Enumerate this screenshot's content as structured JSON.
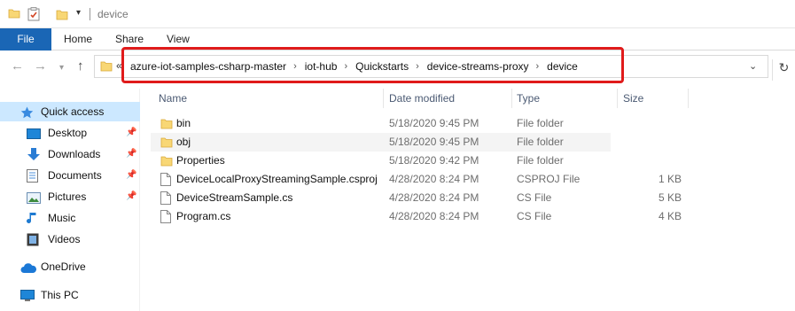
{
  "window": {
    "title": "device"
  },
  "ribbon": {
    "tabs": [
      {
        "label": "File"
      },
      {
        "label": "Home"
      },
      {
        "label": "Share"
      },
      {
        "label": "View"
      }
    ]
  },
  "navigation": {
    "overflow_label": "«",
    "breadcrumbs": [
      "azure-iot-samples-csharp-master",
      "iot-hub",
      "Quickstarts",
      "device-streams-proxy",
      "device"
    ],
    "separator": "›"
  },
  "sidebar": {
    "items": [
      {
        "label": "Quick access",
        "icon": "star-icon",
        "pinned": false
      },
      {
        "label": "Desktop",
        "icon": "desktop-icon",
        "pinned": true
      },
      {
        "label": "Downloads",
        "icon": "download-icon",
        "pinned": true
      },
      {
        "label": "Documents",
        "icon": "documents-icon",
        "pinned": true
      },
      {
        "label": "Pictures",
        "icon": "pictures-icon",
        "pinned": true
      },
      {
        "label": "Music",
        "icon": "music-icon",
        "pinned": false
      },
      {
        "label": "Videos",
        "icon": "videos-icon",
        "pinned": false
      },
      {
        "label": "OneDrive",
        "icon": "cloud-icon",
        "pinned": false
      },
      {
        "label": "This PC",
        "icon": "pc-icon",
        "pinned": false
      }
    ]
  },
  "filelist": {
    "columns": {
      "name": "Name",
      "date": "Date modified",
      "type": "Type",
      "size": "Size"
    },
    "rows": [
      {
        "name": "bin",
        "date": "5/18/2020 9:45 PM",
        "type": "File folder",
        "size": "",
        "icon": "folder-icon"
      },
      {
        "name": "obj",
        "date": "5/18/2020 9:45 PM",
        "type": "File folder",
        "size": "",
        "icon": "folder-icon"
      },
      {
        "name": "Properties",
        "date": "5/18/2020 9:42 PM",
        "type": "File folder",
        "size": "",
        "icon": "folder-icon"
      },
      {
        "name": "DeviceLocalProxyStreamingSample.csproj",
        "date": "4/28/2020 8:24 PM",
        "type": "CSPROJ File",
        "size": "1 KB",
        "icon": "file-icon"
      },
      {
        "name": "DeviceStreamSample.cs",
        "date": "4/28/2020 8:24 PM",
        "type": "CS File",
        "size": "5 KB",
        "icon": "file-icon"
      },
      {
        "name": "Program.cs",
        "date": "4/28/2020 8:24 PM",
        "type": "CS File",
        "size": "4 KB",
        "icon": "file-icon"
      }
    ]
  },
  "colors": {
    "accent": "#1a66b5",
    "selection": "#cce8ff",
    "highlight_box": "#e01b1b",
    "folder": "#f8d775"
  }
}
